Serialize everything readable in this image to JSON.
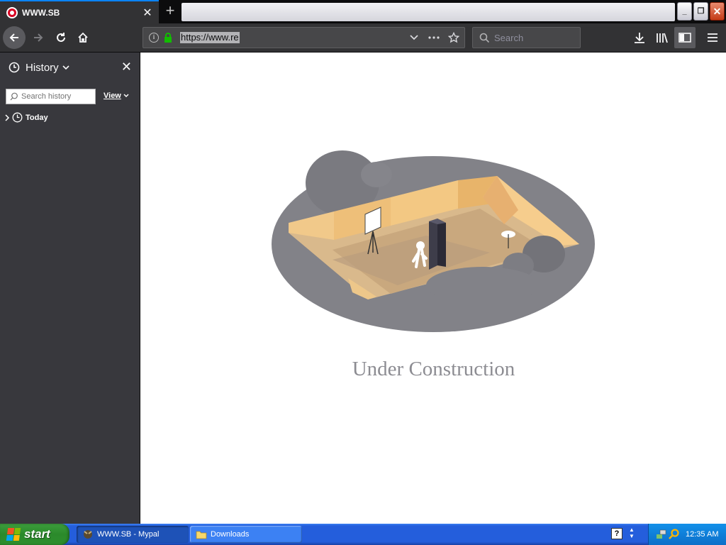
{
  "tab": {
    "title": "WWW.SB",
    "close": "✕"
  },
  "newtab": {
    "label": "+"
  },
  "window_controls": {
    "minimize": "_",
    "restore": "❐",
    "close": "✕"
  },
  "urlbar": {
    "url": "https://www.re",
    "info": "i"
  },
  "searchbar": {
    "placeholder": "Search"
  },
  "sidebar": {
    "title": "History",
    "close": "✕",
    "search_placeholder": "Search history",
    "view_label": "View",
    "tree": [
      {
        "label": "Today"
      }
    ]
  },
  "content": {
    "headline": "Under Construction"
  },
  "taskbar": {
    "start": "start",
    "items": [
      {
        "label": "WWW.SB - Mypal",
        "active": true
      },
      {
        "label": "Downloads",
        "active": false
      }
    ],
    "help": "?",
    "clock": "12:35 AM"
  },
  "colors": {
    "accent": "#0a84ff",
    "toolbar": "#323234",
    "sidebar": "#38383d",
    "taskbar": "#245edc",
    "start": "#2e8f2e"
  }
}
